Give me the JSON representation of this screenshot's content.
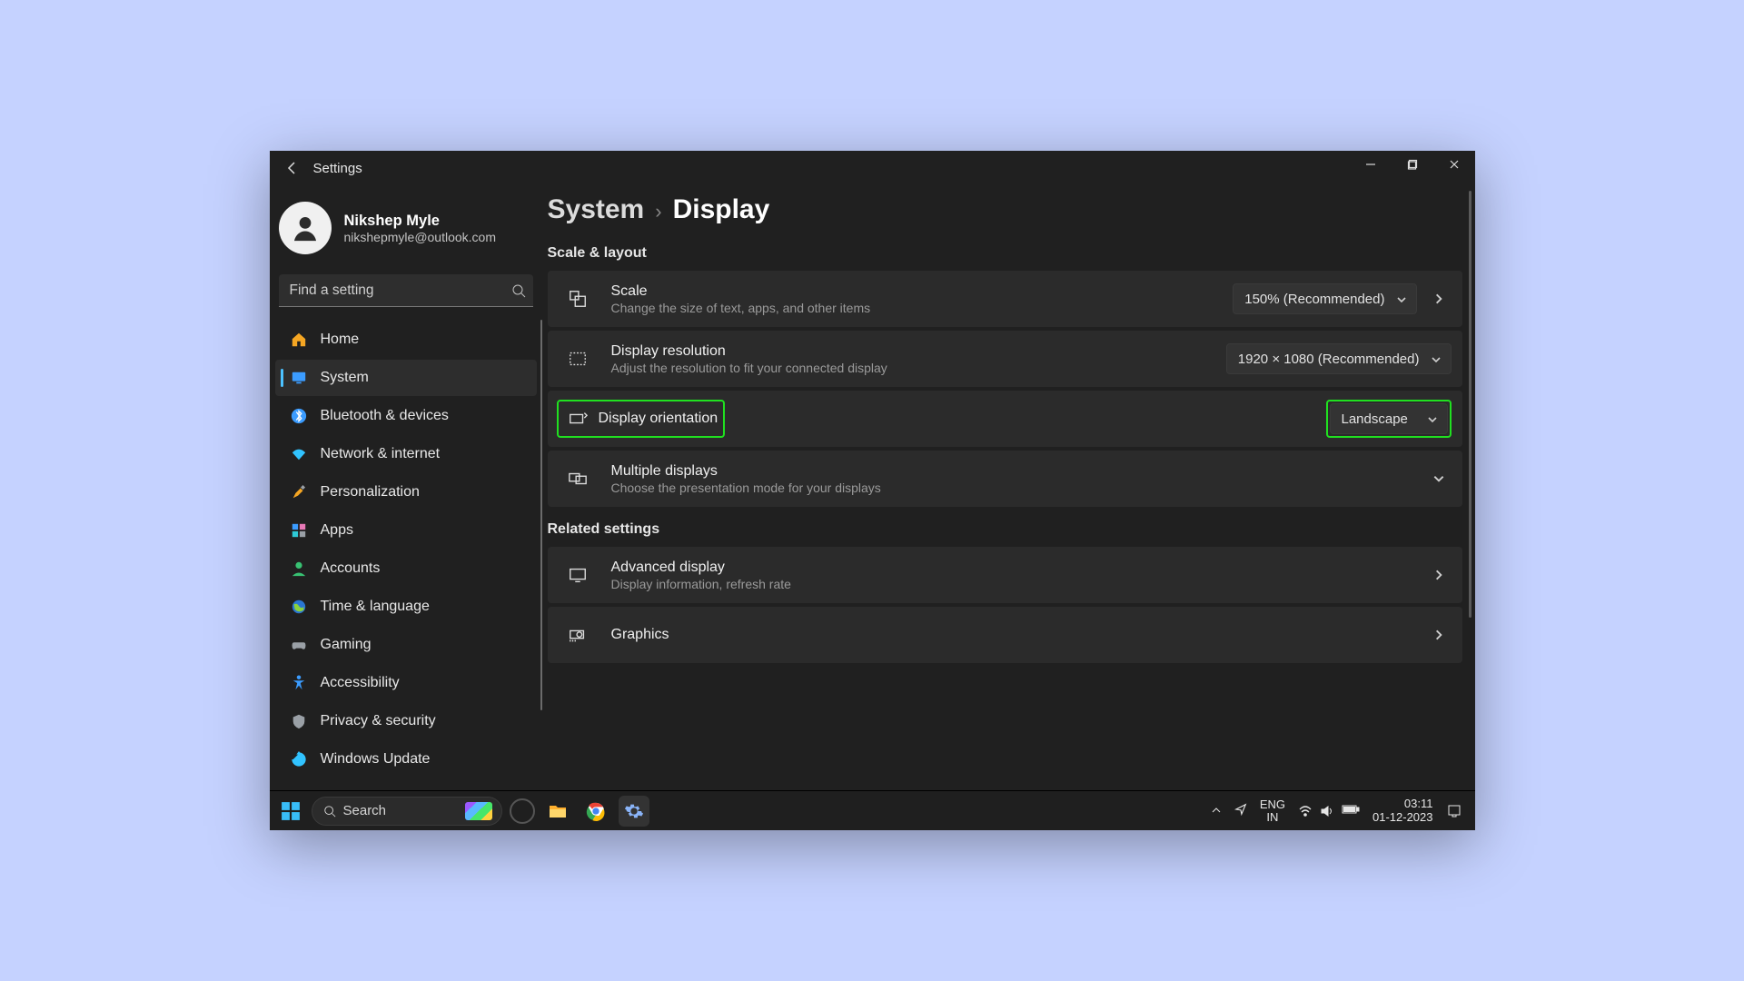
{
  "window": {
    "title": "Settings"
  },
  "user": {
    "name": "Nikshep Myle",
    "email": "nikshepmyle@outlook.com"
  },
  "search": {
    "placeholder": "Find a setting"
  },
  "sidebar": {
    "items": [
      {
        "label": "Home"
      },
      {
        "label": "System"
      },
      {
        "label": "Bluetooth & devices"
      },
      {
        "label": "Network & internet"
      },
      {
        "label": "Personalization"
      },
      {
        "label": "Apps"
      },
      {
        "label": "Accounts"
      },
      {
        "label": "Time & language"
      },
      {
        "label": "Gaming"
      },
      {
        "label": "Accessibility"
      },
      {
        "label": "Privacy & security"
      },
      {
        "label": "Windows Update"
      }
    ],
    "active_index": 1
  },
  "breadcrumb": {
    "parent": "System",
    "current": "Display"
  },
  "sections": {
    "scale_layout": {
      "heading": "Scale & layout",
      "scale": {
        "title": "Scale",
        "desc": "Change the size of text, apps, and other items",
        "value": "150% (Recommended)"
      },
      "resolution": {
        "title": "Display resolution",
        "desc": "Adjust the resolution to fit your connected display",
        "value": "1920 × 1080 (Recommended)"
      },
      "orientation": {
        "title": "Display orientation",
        "value": "Landscape"
      },
      "multiple": {
        "title": "Multiple displays",
        "desc": "Choose the presentation mode for your displays"
      }
    },
    "related": {
      "heading": "Related settings",
      "advanced": {
        "title": "Advanced display",
        "desc": "Display information, refresh rate"
      },
      "graphics": {
        "title": "Graphics"
      }
    }
  },
  "taskbar": {
    "search_label": "Search",
    "lang_top": "ENG",
    "lang_bottom": "IN",
    "time": "03:11",
    "date": "01-12-2023"
  }
}
